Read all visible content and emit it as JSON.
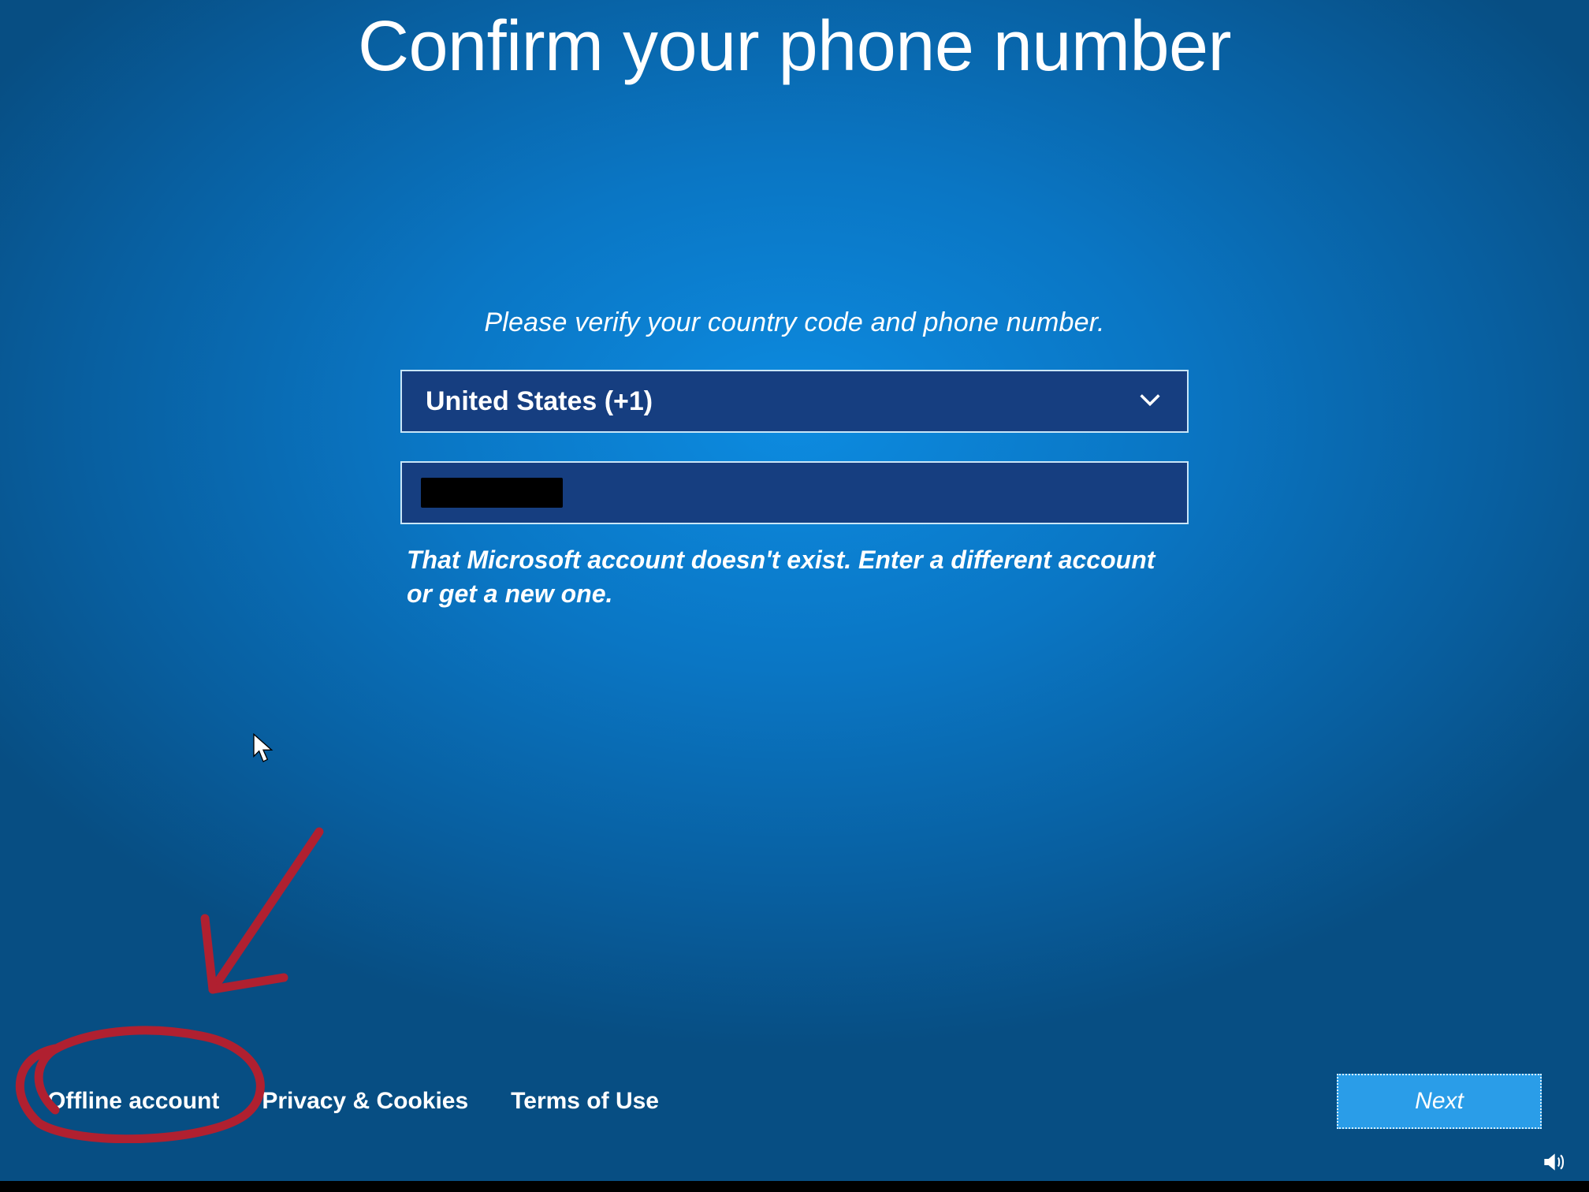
{
  "title": "Confirm your phone number",
  "instruction": "Please verify your country code and phone number.",
  "country_dropdown": {
    "selected": "United States (+1)"
  },
  "phone_input": {
    "value_redacted": true
  },
  "error_message": "That Microsoft account doesn't exist. Enter a different account or get a new one.",
  "bottom_links": {
    "offline_account": "Offline account",
    "privacy_cookies": "Privacy & Cookies",
    "terms_of_use": "Terms of Use"
  },
  "buttons": {
    "next": "Next"
  },
  "annotation": {
    "type": "hand-drawn-arrow-and-circle",
    "target": "offline-account-link",
    "color": "#b02030"
  }
}
